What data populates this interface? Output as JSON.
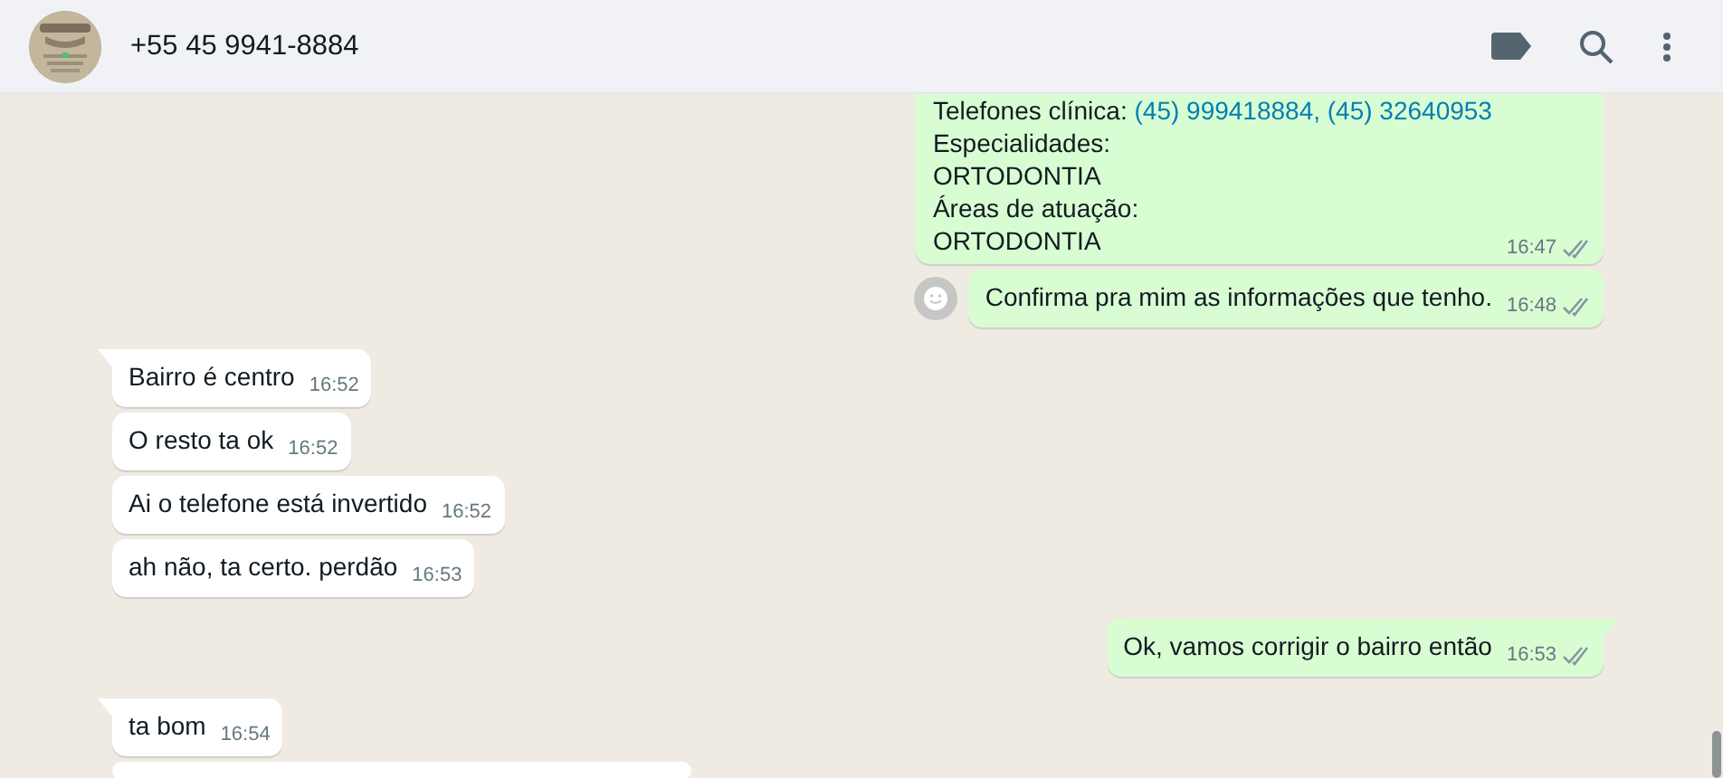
{
  "header": {
    "contact": "+55 45 9941-8884"
  },
  "messages": [
    {
      "kind": "outgoing",
      "tail": false,
      "react_button": false,
      "delivered": true,
      "time": "16:47",
      "lines": [
        [
          {
            "kind": "text",
            "text": "Telefones clínica: "
          },
          {
            "kind": "link",
            "text": "(45) 999418884, (45) 32640953"
          }
        ],
        [
          {
            "kind": "text",
            "text": "Especialidades:"
          }
        ],
        [
          {
            "kind": "text",
            "text": "ORTODONTIA"
          }
        ],
        [
          {
            "kind": "text",
            "text": "Áreas de atuação:"
          }
        ],
        [
          {
            "kind": "text",
            "text": "ORTODONTIA"
          }
        ]
      ]
    },
    {
      "kind": "outgoing",
      "tail": false,
      "react_button": true,
      "delivered": true,
      "time": "16:48",
      "lines": [
        [
          {
            "kind": "text",
            "text": "Confirma pra mim as informações que tenho."
          }
        ]
      ]
    },
    {
      "kind": "incoming",
      "tail": true,
      "react_button": false,
      "time": "16:52",
      "lines": [
        [
          {
            "kind": "text",
            "text": "Bairro é centro"
          }
        ]
      ]
    },
    {
      "kind": "incoming",
      "tail": false,
      "react_button": false,
      "time": "16:52",
      "lines": [
        [
          {
            "kind": "text",
            "text": "O resto ta ok"
          }
        ]
      ]
    },
    {
      "kind": "incoming",
      "tail": false,
      "react_button": false,
      "time": "16:52",
      "lines": [
        [
          {
            "kind": "text",
            "text": "Ai o telefone está invertido"
          }
        ]
      ]
    },
    {
      "kind": "incoming",
      "tail": false,
      "react_button": false,
      "time": "16:53",
      "lines": [
        [
          {
            "kind": "text",
            "text": "ah não, ta certo. perdão"
          }
        ]
      ]
    },
    {
      "kind": "outgoing",
      "tail": true,
      "react_button": false,
      "delivered": true,
      "time": "16:53",
      "lines": [
        [
          {
            "kind": "text",
            "text": "Ok, vamos corrigir o bairro então"
          }
        ]
      ]
    },
    {
      "kind": "incoming",
      "tail": true,
      "react_button": false,
      "time": "16:54",
      "lines": [
        [
          {
            "kind": "text",
            "text": "ta bom"
          }
        ]
      ]
    }
  ]
}
